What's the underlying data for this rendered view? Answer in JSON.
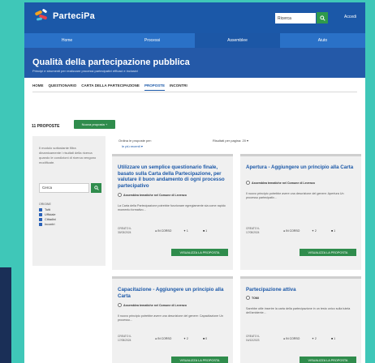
{
  "header": {
    "logo_text": "ParteciPa",
    "search": {
      "value": "Ricerca"
    },
    "access_label": "Accedi"
  },
  "nav": {
    "items": [
      "Home",
      "Processi",
      "Assemblee",
      "Aiuto"
    ],
    "active": 2
  },
  "banner": {
    "title": "Qualità della partecipazione pubblica",
    "subtitle": "Principi e strumenti per realizzare processi partecipativi efficaci e inclusivi"
  },
  "tabs": [
    "HOME",
    "QUESTIONARIO",
    "CARTA DELLA PARTECIPAZIONE",
    "PROPOSTE",
    "INCONTRI"
  ],
  "proposals": {
    "count_label": "11 PROPOSTE",
    "new_button": "Nuova proposta"
  },
  "sidebar": {
    "info": "Il modulo sottostante filtra dinamicamente i risultati della ricerca quando le condizioni di ricerca vengono modificate.",
    "search_value": "Cerca",
    "group_label": "ORIGINE",
    "checks": [
      "Tutti",
      "Ufficiale",
      "Cittadini",
      "Incontri"
    ]
  },
  "results": {
    "order_label": "Ordina le proposte per:",
    "order_value": "le più recenti",
    "per_page": "Risultati per pagina:  20"
  },
  "cards": [
    {
      "title": "Utilizzare un semplice questionario finale, basato sulla Carta della Partecipazione, per valutare il buon andamento di ogni processo partecipativo",
      "author": "Assemblea tematiche nel Comune di Levenzo",
      "body": "La Carta della Partecipazione potrebbe funzionare egregiamente sia come rapido momento formativo...",
      "date_label": "CREATO IL",
      "date": "30/03/2024",
      "state": "IN CORSO",
      "stat_a": "1",
      "stat_b": "1",
      "button": "VISUALIZZA LA PROPOSTA"
    },
    {
      "title": "Apertura - Aggiungere un principio alla Carta",
      "author": "Assemblea tematiche nel Comune di Levenzo",
      "body": "Il nuovo principio potrebbe avere una descrizione del genere: Apertura Un processo partecipativ...",
      "date_label": "CREATO IL",
      "date": "17/05/2024",
      "state": "IN CORSO",
      "stat_a": "2",
      "stat_b": "1",
      "button": "VISUALIZZA LA PROPOSTA"
    },
    {
      "title": "Capacitazione - Aggiungere un principio alla Carta",
      "author": "Assemblea tematiche nel Comune di Levenzo",
      "body": "Il nuovo principio potrebbe avere una descrizione del genere: Capacitazione Un processo...",
      "date_label": "CREATO IL",
      "date": "17/05/2024",
      "state": "IN CORSO",
      "stat_a": "2",
      "stat_b": "0",
      "button": "VISUALIZZA LA PROPOSTA"
    },
    {
      "title": "Partecipazione attiva",
      "author": "TOMI",
      "body": "Sarebbe utile inserire la carta della partecipazione in un testo unico sulla tutela dell'ambiente...",
      "date_label": "CREATO IL",
      "date": "04/12/2023",
      "state": "IN CORSO",
      "stat_a": "2",
      "stat_b": "1",
      "button": "VISUALIZZA LA PROPOSTA"
    }
  ]
}
